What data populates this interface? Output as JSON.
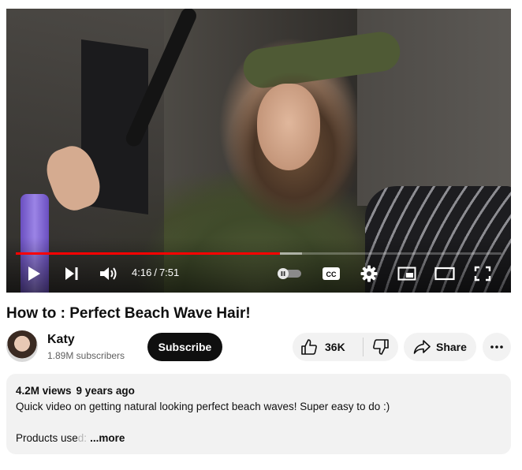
{
  "player": {
    "current_time": "4:16",
    "duration": "7:51",
    "time_separator": "/",
    "played_fraction": 0.544,
    "buffered_fraction": 0.59,
    "cc_label": "CC"
  },
  "video": {
    "title": "How to : Perfect Beach Wave Hair!"
  },
  "channel": {
    "name": "Katy",
    "subscribers": "1.89M subscribers",
    "subscribe_label": "Subscribe"
  },
  "actions": {
    "like_count": "36K",
    "share_label": "Share"
  },
  "description": {
    "views": "4.2M views",
    "age": "9 years ago",
    "text_line1": "Quick video on getting natural looking perfect beach waves!  Super easy to do :)",
    "text_line2_start": "Products use",
    "text_line2_fade": "d:",
    "more_label": "...more"
  },
  "icons": {
    "play": "play-icon",
    "next": "next-icon",
    "volume": "volume-icon",
    "autoplay": "autoplay-toggle",
    "captions": "captions-icon",
    "settings": "gear-icon",
    "miniplayer": "miniplayer-icon",
    "theater": "theater-icon",
    "fullscreen": "fullscreen-icon",
    "like": "thumbs-up-icon",
    "dislike": "thumbs-down-icon",
    "share": "share-arrow-icon",
    "more": "more-dots-icon"
  },
  "colors": {
    "progress_played": "#ff0000",
    "subscribe_bg": "#0f0f0f",
    "pill_bg": "#f2f2f2"
  }
}
